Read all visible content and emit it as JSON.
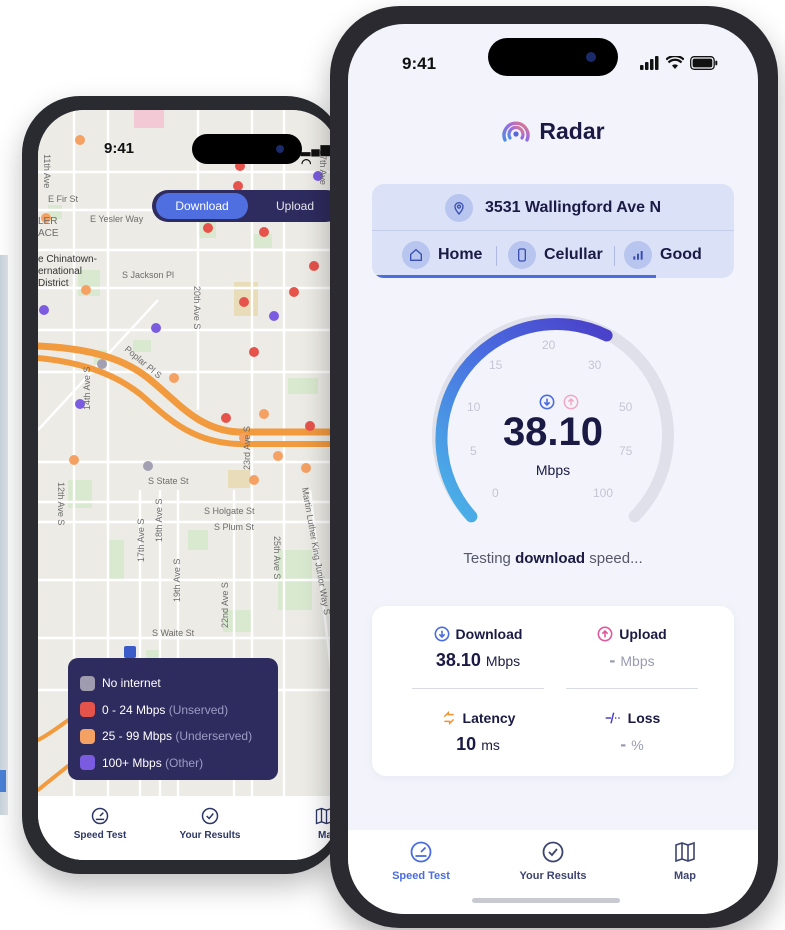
{
  "back_phone": {
    "time": "9:41",
    "status": "▂▄▆ ◠",
    "toggle": {
      "download": "Download",
      "upload": "Upload"
    },
    "streets": {
      "s1": "11th Ave",
      "s2": "E Fir St",
      "s3": "E Yesler Way",
      "s4": "27th Ave",
      "s5": "LER",
      "s6": "ACE",
      "s7": "e Chinatown-",
      "s8": "ernational",
      "s9": "District",
      "s10": "S Jackson Pl",
      "s11": "20th Ave S",
      "s12": "Poplar Pl S",
      "s13": "14th Ave S",
      "s14": "23rd Ave S",
      "s15": "12th Ave S",
      "s16": "S State St",
      "s17": "S Holgate St",
      "s18": "S Plum St",
      "s19": "Martin Luther King Junior Way S",
      "s20": "17th Ave S",
      "s21": "18th Ave S",
      "s22": "19th Ave S",
      "s23": "25th Ave S",
      "s24": "22nd Ave S",
      "s25": "S Waite St"
    },
    "legend": [
      {
        "label": "No internet",
        "note": "",
        "color": "#9e9cae"
      },
      {
        "label": "0 - 24 Mbps",
        "note": "(Unserved)",
        "color": "#e5534b"
      },
      {
        "label": "25 - 99 Mbps",
        "note": "(Underserved)",
        "color": "#f4a163"
      },
      {
        "label": "100+ Mbps",
        "note": "(Other)",
        "color": "#7b5ce0"
      }
    ],
    "tabs": {
      "speed_test": "Speed Test",
      "your_results": "Your Results",
      "map": "Map"
    }
  },
  "front_phone": {
    "time": "9:41",
    "brand": "Radar",
    "address": "3531 Wallingford Ave N",
    "chips": {
      "home": "Home",
      "network": "Celullar",
      "signal": "Good"
    },
    "gauge": {
      "ticks": [
        "0",
        "5",
        "10",
        "15",
        "20",
        "30",
        "50",
        "75",
        "100"
      ],
      "value": "38.10",
      "unit": "Mbps"
    },
    "testing": {
      "pre": "Testing ",
      "bold": "download",
      "post": " speed..."
    },
    "stats": {
      "download": {
        "label": "Download",
        "value": "38.10",
        "unit": "Mbps"
      },
      "upload": {
        "label": "Upload",
        "value": "-",
        "unit": "Mbps"
      },
      "latency": {
        "label": "Latency",
        "value": "10",
        "unit": "ms"
      },
      "loss": {
        "label": "Loss",
        "value": "-",
        "unit": "%"
      }
    },
    "tabs": {
      "speed_test": "Speed Test",
      "your_results": "Your Results",
      "map": "Map"
    },
    "colors": {
      "accent": "#4a6ce0",
      "navy": "#1a1a44",
      "upload_pink": "#e0579b",
      "latency_orange": "#f0922f"
    }
  }
}
